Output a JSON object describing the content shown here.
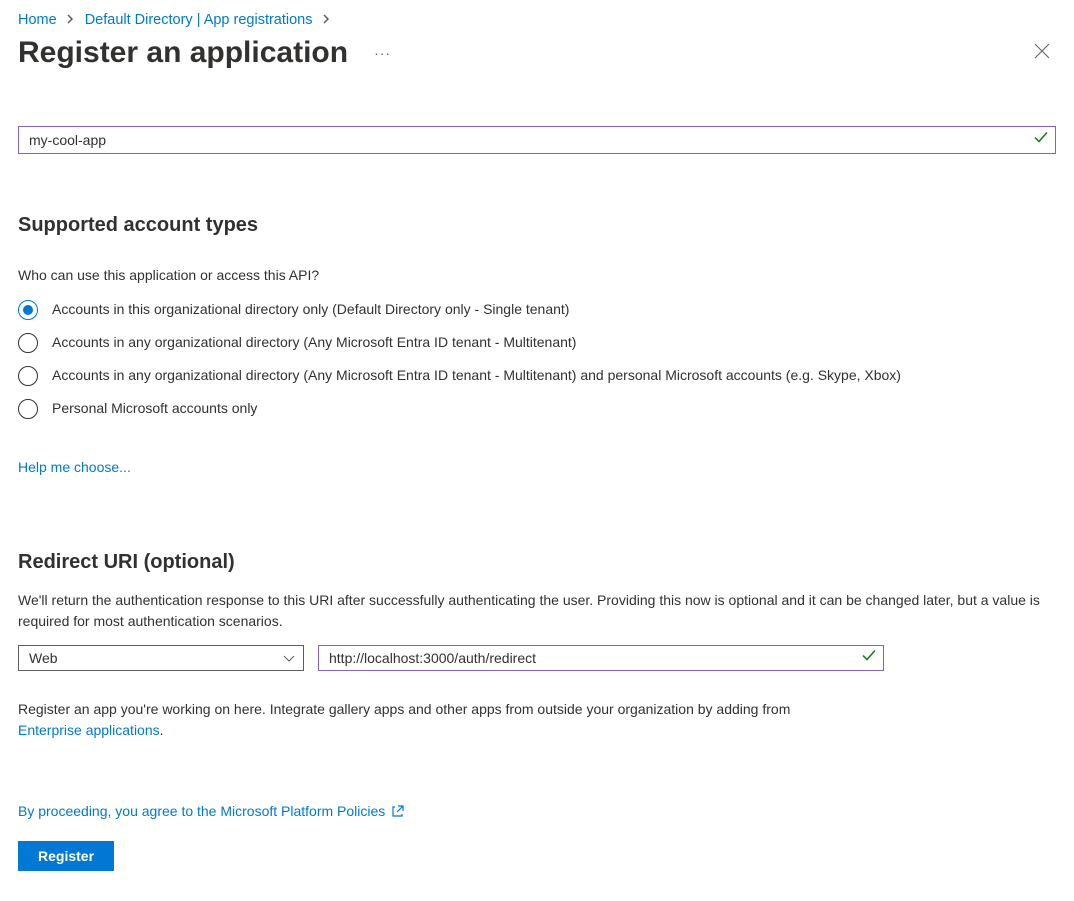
{
  "breadcrumb": {
    "home": "Home",
    "dir": "Default Directory | App registrations"
  },
  "page_title": "Register an application",
  "name_field": {
    "value": "my-cool-app"
  },
  "account_types": {
    "heading": "Supported account types",
    "question": "Who can use this application or access this API?",
    "options": [
      "Accounts in this organizational directory only (Default Directory only - Single tenant)",
      "Accounts in any organizational directory (Any Microsoft Entra ID tenant - Multitenant)",
      "Accounts in any organizational directory (Any Microsoft Entra ID tenant - Multitenant) and personal Microsoft accounts (e.g. Skype, Xbox)",
      "Personal Microsoft accounts only"
    ],
    "help_link": "Help me choose..."
  },
  "redirect": {
    "heading": "Redirect URI (optional)",
    "desc": "We'll return the authentication response to this URI after successfully authenticating the user. Providing this now is optional and it can be changed later, but a value is required for most authentication scenarios.",
    "platform_selected": "Web",
    "uri_value": "http://localhost:3000/auth/redirect"
  },
  "footer_hint": {
    "text": "Register an app you're working on here. Integrate gallery apps and other apps from outside your organization by adding from ",
    "link": "Enterprise applications"
  },
  "policy": "By proceeding, you agree to the Microsoft Platform Policies",
  "register_button": "Register"
}
